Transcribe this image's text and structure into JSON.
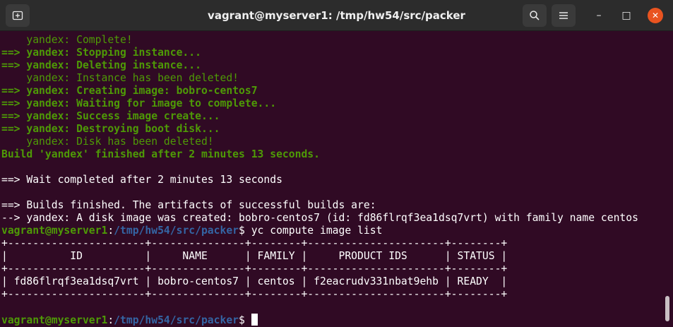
{
  "window": {
    "title": "vagrant@myserver1: /tmp/hw54/src/packer"
  },
  "toolbar": {
    "new_tab_icon": "new-tab-icon",
    "search_icon": "search-icon",
    "menu_icon": "hamburger-menu-icon"
  },
  "controls": {
    "minimize": "–",
    "maximize": "□",
    "close": "✕"
  },
  "colors": {
    "background": "#300a24",
    "green": "#4e9a06",
    "blue": "#3465a4",
    "close_button": "#e95420"
  },
  "terminal": {
    "lines": [
      {
        "segments": [
          {
            "t": "    yandex: Complete!",
            "c": "gi"
          }
        ]
      },
      {
        "segments": [
          {
            "t": "==> yandex: Stopping instance...",
            "c": "gb"
          }
        ]
      },
      {
        "segments": [
          {
            "t": "==> yandex: Deleting instance...",
            "c": "gb"
          }
        ]
      },
      {
        "segments": [
          {
            "t": "    yandex: Instance has been deleted!",
            "c": "gi"
          }
        ]
      },
      {
        "segments": [
          {
            "t": "==> yandex: Creating image: bobro-centos7",
            "c": "gb"
          }
        ]
      },
      {
        "segments": [
          {
            "t": "==> yandex: Waiting for image to complete...",
            "c": "gb"
          }
        ]
      },
      {
        "segments": [
          {
            "t": "==> yandex: Success image create...",
            "c": "gb"
          }
        ]
      },
      {
        "segments": [
          {
            "t": "==> yandex: Destroying boot disk...",
            "c": "gb"
          }
        ]
      },
      {
        "segments": [
          {
            "t": "    yandex: Disk has been deleted!",
            "c": "gi"
          }
        ]
      },
      {
        "segments": [
          {
            "t": "Build 'yandex' finished after 2 minutes 13 seconds.",
            "c": "gb"
          }
        ]
      },
      {
        "segments": [
          {
            "t": "",
            "c": "w"
          }
        ]
      },
      {
        "segments": [
          {
            "t": "==> Wait completed after 2 minutes 13 seconds",
            "c": "w"
          }
        ]
      },
      {
        "segments": [
          {
            "t": "",
            "c": "w"
          }
        ]
      },
      {
        "segments": [
          {
            "t": "==> Builds finished. The artifacts of successful builds are:",
            "c": "w"
          }
        ]
      },
      {
        "segments": [
          {
            "t": "--> yandex: A disk image was created: bobro-centos7 (id: fd86flrqf3ea1dsq7vrt) with family name centos",
            "c": "w"
          }
        ]
      },
      {
        "segments": [
          {
            "t": "vagrant@myserver1",
            "c": "pu"
          },
          {
            "t": ":",
            "c": "w"
          },
          {
            "t": "/tmp/hw54/src/packer",
            "c": "pp"
          },
          {
            "t": "$ yc compute image list",
            "c": "w"
          }
        ]
      },
      {
        "segments": [
          {
            "t": "+----------------------+---------------+--------+----------------------+--------+",
            "c": "w"
          }
        ]
      },
      {
        "segments": [
          {
            "t": "|          ID          |     NAME      | FAMILY |     PRODUCT IDS      | STATUS |",
            "c": "w"
          }
        ]
      },
      {
        "segments": [
          {
            "t": "+----------------------+---------------+--------+----------------------+--------+",
            "c": "w"
          }
        ]
      },
      {
        "segments": [
          {
            "t": "| fd86flrqf3ea1dsq7vrt | bobro-centos7 | centos | f2eacrudv331nbat9ehb | READY  |",
            "c": "w"
          }
        ]
      },
      {
        "segments": [
          {
            "t": "+----------------------+---------------+--------+----------------------+--------+",
            "c": "w"
          }
        ]
      },
      {
        "segments": [
          {
            "t": "",
            "c": "w"
          }
        ]
      },
      {
        "segments": [
          {
            "t": "vagrant@myserver1",
            "c": "pu"
          },
          {
            "t": ":",
            "c": "w"
          },
          {
            "t": "/tmp/hw54/src/packer",
            "c": "pp"
          },
          {
            "t": "$ ",
            "c": "w"
          }
        ],
        "cursor": true
      }
    ]
  }
}
